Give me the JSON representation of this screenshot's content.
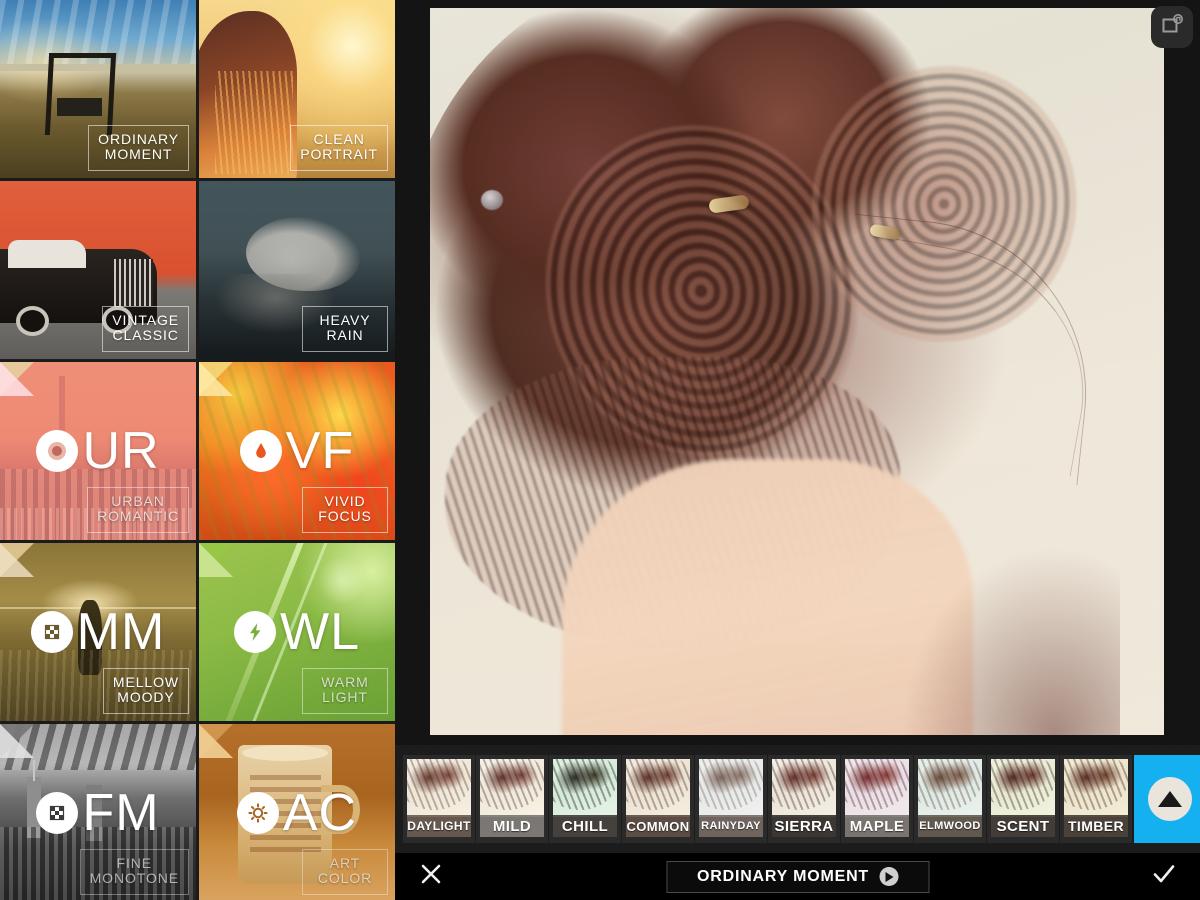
{
  "app": {
    "background": "#131313",
    "accent": "#14b0f0"
  },
  "presets": {
    "items": [
      {
        "id": "ordinary-moment",
        "abbr": "",
        "icon": "",
        "label_line1": "ORDINARY",
        "label_line2": "MOMENT",
        "selected": true,
        "badge": false,
        "label_style": "normal"
      },
      {
        "id": "clean-portrait",
        "abbr": "",
        "icon": "",
        "label_line1": "CLEAN",
        "label_line2": "PORTRAIT",
        "selected": false,
        "badge": false,
        "label_style": "normal"
      },
      {
        "id": "vintage-classic",
        "abbr": "",
        "icon": "",
        "label_line1": "VINTAGE",
        "label_line2": "CLASSIC",
        "selected": false,
        "badge": false,
        "label_style": "normal"
      },
      {
        "id": "heavy-rain",
        "abbr": "",
        "icon": "",
        "label_line1": "HEAVY",
        "label_line2": "RAIN",
        "selected": false,
        "badge": false,
        "label_style": "normal"
      },
      {
        "id": "urban-romantic",
        "abbr": "UR",
        "icon": "vignette-icon",
        "label_line1": "URBAN",
        "label_line2": "ROMANTIC",
        "selected": false,
        "badge": true,
        "label_style": "dim"
      },
      {
        "id": "vivid-focus",
        "abbr": "VF",
        "icon": "droplet-icon",
        "label_line1": "VIVID",
        "label_line2": "FOCUS",
        "selected": false,
        "badge": true,
        "label_style": "normal"
      },
      {
        "id": "mellow-moody",
        "abbr": "MM",
        "icon": "checkerboard-icon",
        "label_line1": "MELLOW",
        "label_line2": "MOODY",
        "selected": false,
        "badge": true,
        "label_style": "normal"
      },
      {
        "id": "warm-light",
        "abbr": "WL",
        "icon": "lightning-icon",
        "label_line1": "WARM",
        "label_line2": "LIGHT",
        "selected": false,
        "badge": true,
        "label_style": "dim"
      },
      {
        "id": "fine-monotone",
        "abbr": "FM",
        "icon": "checkerboard-icon",
        "label_line1": "FINE",
        "label_line2": "MONOTONE",
        "selected": false,
        "badge": true,
        "label_style": "dim2"
      },
      {
        "id": "art-color",
        "abbr": "AC",
        "icon": "sun-icon",
        "label_line1": "ART",
        "label_line2": "COLOR",
        "selected": false,
        "badge": true,
        "label_style": "dim2"
      }
    ]
  },
  "stage": {
    "compare_button_icon": "revert-photo-icon"
  },
  "filmstrip": {
    "thumbnails": [
      {
        "id": "daylight",
        "label": "DAYLIGHT",
        "selected": false
      },
      {
        "id": "mild",
        "label": "MILD",
        "selected": true
      },
      {
        "id": "chill",
        "label": "CHILL",
        "selected": false
      },
      {
        "id": "common",
        "label": "COMMON",
        "selected": false
      },
      {
        "id": "rainyday",
        "label": "RAINYDAY",
        "selected": false
      },
      {
        "id": "sierra",
        "label": "SIERRA",
        "selected": false
      },
      {
        "id": "maple",
        "label": "MAPLE",
        "selected": true
      },
      {
        "id": "elmwood",
        "label": "ELMWOOD",
        "selected": false
      },
      {
        "id": "scent",
        "label": "SCENT",
        "selected": false
      },
      {
        "id": "timber",
        "label": "TIMBER",
        "selected": false
      }
    ],
    "toggle_icon": "triangle-up-icon",
    "toggle_color": "#14b0f0"
  },
  "bottom_bar": {
    "cancel_icon": "close-icon",
    "confirm_icon": "check-icon",
    "preset_name": "ORDINARY MOMENT",
    "preset_play_icon": "play-icon"
  }
}
